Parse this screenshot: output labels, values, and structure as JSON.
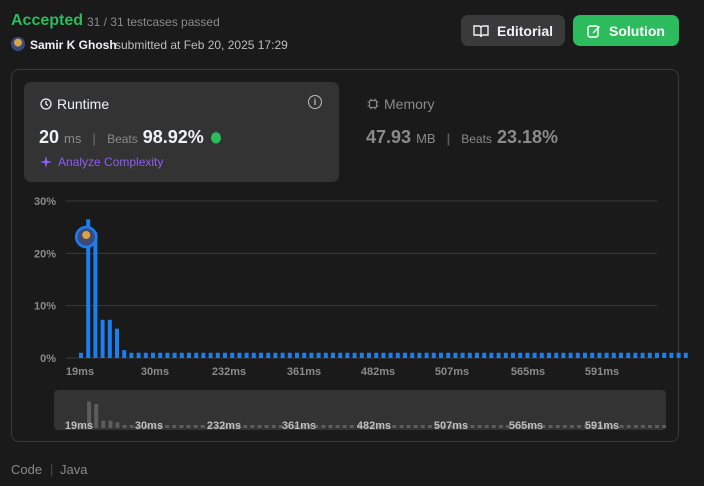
{
  "header": {
    "status": "Accepted",
    "testcases": "31 / 31 testcases passed",
    "user": "Samir K Ghosh",
    "submitted": "submitted at Feb 20, 2025 17:29",
    "editorial_label": "Editorial",
    "solution_label": "Solution"
  },
  "runtime": {
    "title": "Runtime",
    "value": "20",
    "unit": "ms",
    "beats_label": "Beats",
    "beats": "98.92%",
    "analyze": "Analyze Complexity"
  },
  "memory": {
    "title": "Memory",
    "value": "47.93",
    "unit": "MB",
    "beats_label": "Beats",
    "beats": "23.18%"
  },
  "footer": {
    "code_label": "Code",
    "language": "Java"
  },
  "colors": {
    "accent_green": "#2cbb5d",
    "bar_blue": "#1a7ff0",
    "purple": "#8b5cf6"
  },
  "chart_data": {
    "type": "bar",
    "y_ticks": [
      "30%",
      "20%",
      "10%",
      "0%"
    ],
    "ylim": [
      0,
      30
    ],
    "x_tick_labels": [
      "19ms",
      "30ms",
      "232ms",
      "361ms",
      "482ms",
      "507ms",
      "565ms",
      "591ms"
    ],
    "values": [
      1,
      26.5,
      24,
      7.3,
      7.3,
      5.6,
      1.5,
      1,
      1,
      1,
      1,
      1,
      1,
      1,
      1,
      1,
      1,
      1,
      1,
      1,
      1,
      1,
      1,
      1,
      1,
      1,
      1,
      1,
      1,
      1,
      1,
      1,
      1,
      1,
      1,
      1,
      1,
      1,
      1,
      1,
      1,
      1,
      1,
      1,
      1,
      1,
      1,
      1,
      1,
      1,
      1,
      1,
      1,
      1,
      1,
      1,
      1,
      1,
      1,
      1,
      1,
      1,
      1,
      1,
      1,
      1,
      1,
      1,
      1,
      1,
      1,
      1,
      1,
      1,
      1,
      1,
      1,
      1,
      1,
      1,
      1,
      1,
      1,
      1,
      1
    ],
    "highlight_index": 1,
    "grid": true
  }
}
